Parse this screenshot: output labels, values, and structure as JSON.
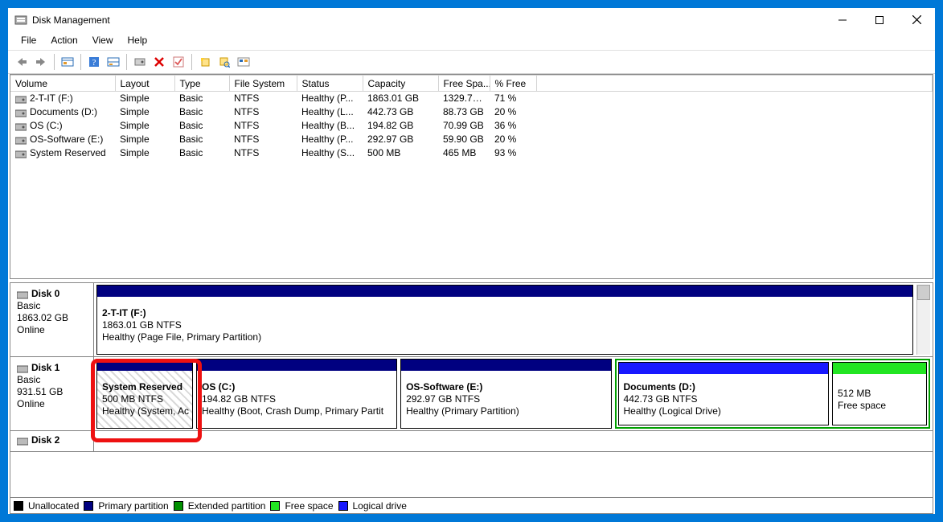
{
  "window": {
    "title": "Disk Management"
  },
  "menu": {
    "file": "File",
    "action": "Action",
    "view": "View",
    "help": "Help"
  },
  "columns": {
    "volume": "Volume",
    "layout": "Layout",
    "type": "Type",
    "fs": "File System",
    "status": "Status",
    "capacity": "Capacity",
    "freespace": "Free Spa...",
    "pctfree": "% Free"
  },
  "volumes": [
    {
      "name": "2-T-IT (F:)",
      "layout": "Simple",
      "type": "Basic",
      "fs": "NTFS",
      "status": "Healthy (P...",
      "capacity": "1863.01 GB",
      "free": "1329.74 ...",
      "pct": "71 %"
    },
    {
      "name": "Documents (D:)",
      "layout": "Simple",
      "type": "Basic",
      "fs": "NTFS",
      "status": "Healthy (L...",
      "capacity": "442.73 GB",
      "free": "88.73 GB",
      "pct": "20 %"
    },
    {
      "name": "OS (C:)",
      "layout": "Simple",
      "type": "Basic",
      "fs": "NTFS",
      "status": "Healthy (B...",
      "capacity": "194.82 GB",
      "free": "70.99 GB",
      "pct": "36 %"
    },
    {
      "name": "OS-Software (E:)",
      "layout": "Simple",
      "type": "Basic",
      "fs": "NTFS",
      "status": "Healthy (P...",
      "capacity": "292.97 GB",
      "free": "59.90 GB",
      "pct": "20 %"
    },
    {
      "name": "System Reserved",
      "layout": "Simple",
      "type": "Basic",
      "fs": "NTFS",
      "status": "Healthy (S...",
      "capacity": "500 MB",
      "free": "465 MB",
      "pct": "93 %"
    }
  ],
  "disks": {
    "d0": {
      "label": "Disk 0",
      "kind": "Basic",
      "size": "1863.02 GB",
      "state": "Online"
    },
    "d1": {
      "label": "Disk 1",
      "kind": "Basic",
      "size": "931.51 GB",
      "state": "Online"
    },
    "d2": {
      "label": "Disk 2"
    }
  },
  "parts": {
    "d0p0": {
      "title": "2-T-IT  (F:)",
      "sub": "1863.01 GB NTFS",
      "status": "Healthy (Page File, Primary Partition)"
    },
    "d1p0": {
      "title": "System Reserved",
      "sub": "500 MB NTFS",
      "status": "Healthy (System, Ac"
    },
    "d1p1": {
      "title": "OS  (C:)",
      "sub": "194.82 GB NTFS",
      "status": "Healthy (Boot, Crash Dump, Primary Partit"
    },
    "d1p2": {
      "title": "OS-Software  (E:)",
      "sub": "292.97 GB NTFS",
      "status": "Healthy (Primary Partition)"
    },
    "d1p3": {
      "title": "Documents  (D:)",
      "sub": "442.73 GB NTFS",
      "status": "Healthy (Logical Drive)"
    },
    "d1p4": {
      "title": "",
      "sub": "512 MB",
      "status": "Free space"
    }
  },
  "legend": {
    "unalloc": "Unallocated",
    "primary": "Primary partition",
    "extended": "Extended partition",
    "freespace": "Free space",
    "logical": "Logical drive"
  }
}
